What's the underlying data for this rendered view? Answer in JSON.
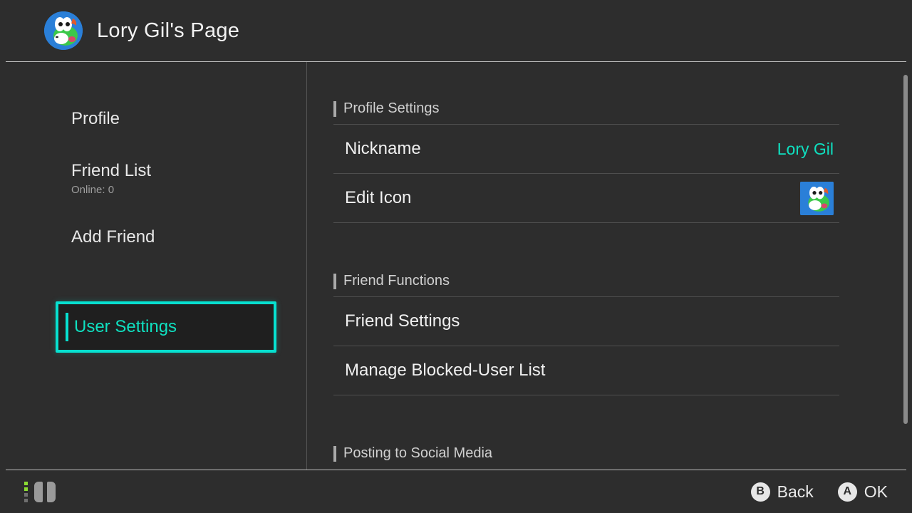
{
  "header": {
    "title": "Lory Gil's Page"
  },
  "sidebar": {
    "items": [
      {
        "label": "Profile"
      },
      {
        "label": "Friend List",
        "sub": "Online: 0"
      },
      {
        "label": "Add Friend"
      },
      {
        "label": "User Settings"
      }
    ],
    "selected_index": 3
  },
  "sections": [
    {
      "title": "Profile Settings",
      "rows": [
        {
          "label": "Nickname",
          "value": "Lory Gil",
          "type": "text"
        },
        {
          "label": "Edit Icon",
          "type": "icon"
        }
      ]
    },
    {
      "title": "Friend Functions",
      "rows": [
        {
          "label": "Friend Settings",
          "type": "plain"
        },
        {
          "label": "Manage Blocked-User List",
          "type": "plain"
        }
      ]
    },
    {
      "title": "Posting to Social Media",
      "rows": []
    }
  ],
  "footer": {
    "actions": [
      {
        "button": "B",
        "label": "Back"
      },
      {
        "button": "A",
        "label": "OK"
      }
    ]
  },
  "colors": {
    "accent": "#0fe0c0",
    "highlight_border": "#07e0d0"
  }
}
